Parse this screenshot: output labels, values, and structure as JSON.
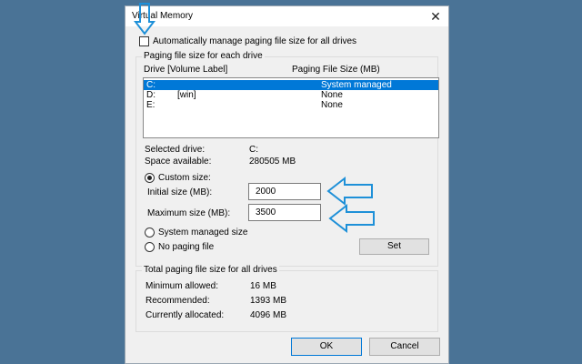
{
  "window": {
    "title": "Virtual Memory"
  },
  "auto_manage": {
    "label": "Automatically manage paging file size for all drives",
    "checked": false
  },
  "paging_group": {
    "legend": "Paging file size for each drive",
    "col_drive": "Drive  [Volume Label]",
    "col_size": "Paging File Size (MB)",
    "drives": [
      {
        "drive": "C:",
        "label": "",
        "size": "System managed",
        "selected": true
      },
      {
        "drive": "D:",
        "label": "[win]",
        "size": "None",
        "selected": false
      },
      {
        "drive": "E:",
        "label": "",
        "size": "None",
        "selected": false
      }
    ]
  },
  "selected_drive": {
    "label": "Selected drive:",
    "value": "C:"
  },
  "space_available": {
    "label": "Space available:",
    "value": "280505 MB"
  },
  "custom_size": {
    "label": "Custom size:",
    "selected": true
  },
  "initial_size": {
    "label": "Initial size (MB):",
    "value": "2000"
  },
  "maximum_size": {
    "label": "Maximum size (MB):",
    "value": "3500"
  },
  "system_managed": {
    "label": "System managed size"
  },
  "no_paging": {
    "label": "No paging file"
  },
  "set_button": "Set",
  "total_group": {
    "legend": "Total paging file size for all drives",
    "rows": [
      {
        "label": "Minimum allowed:",
        "value": "16 MB"
      },
      {
        "label": "Recommended:",
        "value": "1393 MB"
      },
      {
        "label": "Currently allocated:",
        "value": "4096 MB"
      }
    ]
  },
  "ok_button": "OK",
  "cancel_button": "Cancel",
  "colors": {
    "background": "#4a7396",
    "annotation_arrow": "#1e90d8",
    "selection": "#0078d7"
  },
  "icons": {
    "close": "close-icon",
    "annotation": "arrow-icon"
  }
}
